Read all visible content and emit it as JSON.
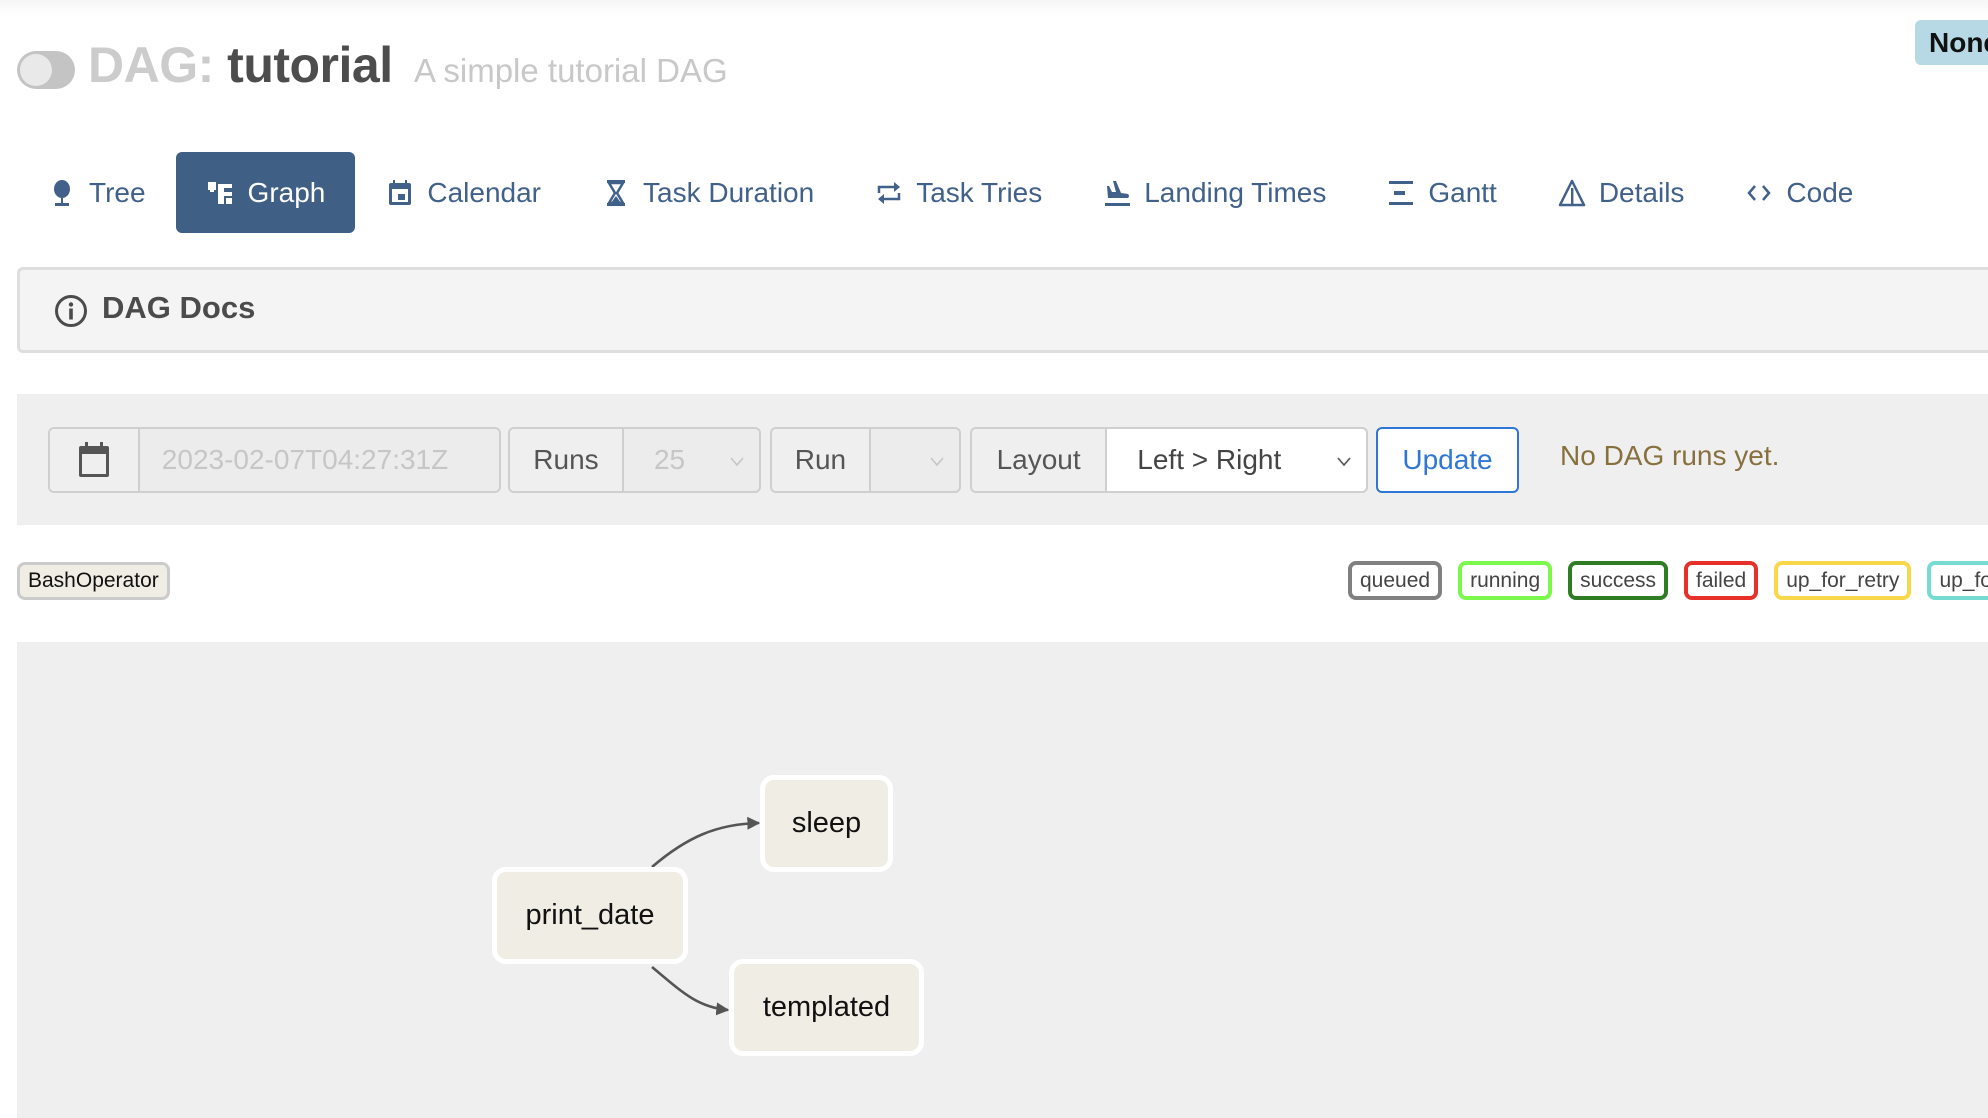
{
  "header": {
    "dag_prefix": "DAG:",
    "dag_id": "tutorial",
    "description": "A simple tutorial DAG",
    "paused_toggle": "off",
    "schedule_badge": "None"
  },
  "nav": {
    "tabs": [
      {
        "label": "Tree",
        "icon": "tree-icon",
        "active": false
      },
      {
        "label": "Graph",
        "icon": "graph-icon",
        "active": true
      },
      {
        "label": "Calendar",
        "icon": "calendar-icon",
        "active": false
      },
      {
        "label": "Task Duration",
        "icon": "hourglass-icon",
        "active": false
      },
      {
        "label": "Task Tries",
        "icon": "retry-icon",
        "active": false
      },
      {
        "label": "Landing Times",
        "icon": "plane-landing-icon",
        "active": false
      },
      {
        "label": "Gantt",
        "icon": "gantt-icon",
        "active": false
      },
      {
        "label": "Details",
        "icon": "warning-triangle-icon",
        "active": false
      },
      {
        "label": "Code",
        "icon": "code-icon",
        "active": false
      }
    ]
  },
  "docs": {
    "label": "DAG Docs",
    "icon": "info-icon"
  },
  "form": {
    "base_date": "2023-02-07T04:27:31Z",
    "runs_label": "Runs",
    "runs_value": "25",
    "run_label": "Run",
    "run_value": "",
    "layout_label": "Layout",
    "layout_value": "Left > Right",
    "update_label": "Update",
    "status_message": "No DAG runs yet."
  },
  "legend": {
    "operators": [
      {
        "label": "BashOperator",
        "color": "#f0ede4"
      }
    ],
    "states": [
      {
        "label": "queued",
        "color": "#808080"
      },
      {
        "label": "running",
        "color": "#7cf74c"
      },
      {
        "label": "success",
        "color": "#2e7d22"
      },
      {
        "label": "failed",
        "color": "#e8302a"
      },
      {
        "label": "up_for_retry",
        "color": "#f8d84a"
      },
      {
        "label": "up_fo",
        "color": "#76dbd3"
      }
    ]
  },
  "graph": {
    "nodes": [
      {
        "id": "print_date",
        "label": "print_date"
      },
      {
        "id": "sleep",
        "label": "sleep"
      },
      {
        "id": "templated",
        "label": "templated"
      }
    ],
    "edges": [
      {
        "from": "print_date",
        "to": "sleep"
      },
      {
        "from": "print_date",
        "to": "templated"
      }
    ]
  }
}
